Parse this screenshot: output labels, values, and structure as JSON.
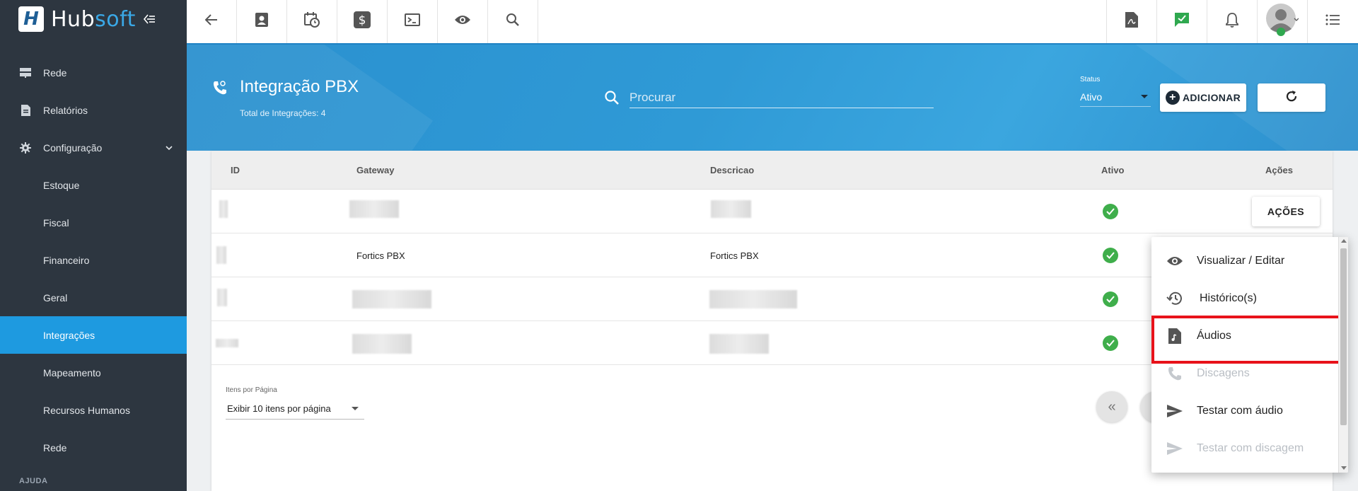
{
  "brand": {
    "name_white": "Hub",
    "name_blue": "soft",
    "badge": "H"
  },
  "sidebar": {
    "items": [
      {
        "label": "Rede",
        "icon": "server-icon",
        "level": "top"
      },
      {
        "label": "Relatórios",
        "icon": "file-icon",
        "level": "top"
      },
      {
        "label": "Configuração",
        "icon": "gear-icon",
        "level": "top",
        "expanded": true
      },
      {
        "label": "Estoque",
        "level": "sub"
      },
      {
        "label": "Fiscal",
        "level": "sub"
      },
      {
        "label": "Financeiro",
        "level": "sub"
      },
      {
        "label": "Geral",
        "level": "sub"
      },
      {
        "label": "Integrações",
        "level": "sub",
        "active": true
      },
      {
        "label": "Mapeamento",
        "level": "sub"
      },
      {
        "label": "Recursos Humanos",
        "level": "sub"
      },
      {
        "label": "Rede",
        "level": "sub"
      }
    ],
    "section_label": "AJUDA"
  },
  "topbar": {
    "left_icons": [
      "back-arrow-icon",
      "contact-card-icon",
      "calendar-clock-icon",
      "dollar-icon",
      "terminal-icon",
      "eye-icon",
      "search-icon"
    ],
    "right_icons": [
      "pdf-icon",
      "chat-check-icon",
      "bell-icon",
      "avatar",
      "list-icon"
    ]
  },
  "header": {
    "title": "Integração PBX",
    "subtitle": "Total de Integrações: 4",
    "search_placeholder": "Procurar",
    "status_label": "Status",
    "status_value": "Ativo",
    "add_label": "ADICIONAR"
  },
  "table": {
    "columns": [
      "ID",
      "Gateway",
      "Descricao",
      "Ativo",
      "Ações"
    ],
    "rows": [
      {
        "id": "",
        "gateway": "",
        "descricao": "",
        "ativo": true,
        "redacted": true
      },
      {
        "id": "",
        "gateway": "Fortics PBX",
        "descricao": "Fortics PBX",
        "ativo": true,
        "redacted": false
      },
      {
        "id": "",
        "gateway": "",
        "descricao": "",
        "ativo": true,
        "redacted": true
      },
      {
        "id": "",
        "gateway": "",
        "descricao": "",
        "ativo": true,
        "redacted": true
      }
    ],
    "actions_label": "AÇÕES"
  },
  "pagination": {
    "per_page_label": "Itens por Página",
    "per_page_value": "Exibir 10 itens por página",
    "first_icon": "«"
  },
  "actions_menu": {
    "items": [
      {
        "label": "Visualizar / Editar",
        "icon": "eye-icon",
        "disabled": false
      },
      {
        "label": "Histórico(s)",
        "icon": "history-icon",
        "disabled": false
      },
      {
        "label": "Áudios",
        "icon": "audio-file-icon",
        "disabled": false,
        "highlighted": true
      },
      {
        "label": "Discagens",
        "icon": "phone-icon",
        "disabled": true
      },
      {
        "label": "Testar com áudio",
        "icon": "send-icon",
        "disabled": false
      },
      {
        "label": "Testar com discagem",
        "icon": "send-icon",
        "disabled": true
      }
    ]
  },
  "colors": {
    "accent": "#1e9ae0",
    "sidebar": "#2d3640",
    "highlight_border": "#e8121a",
    "check": "#3fae4b"
  }
}
